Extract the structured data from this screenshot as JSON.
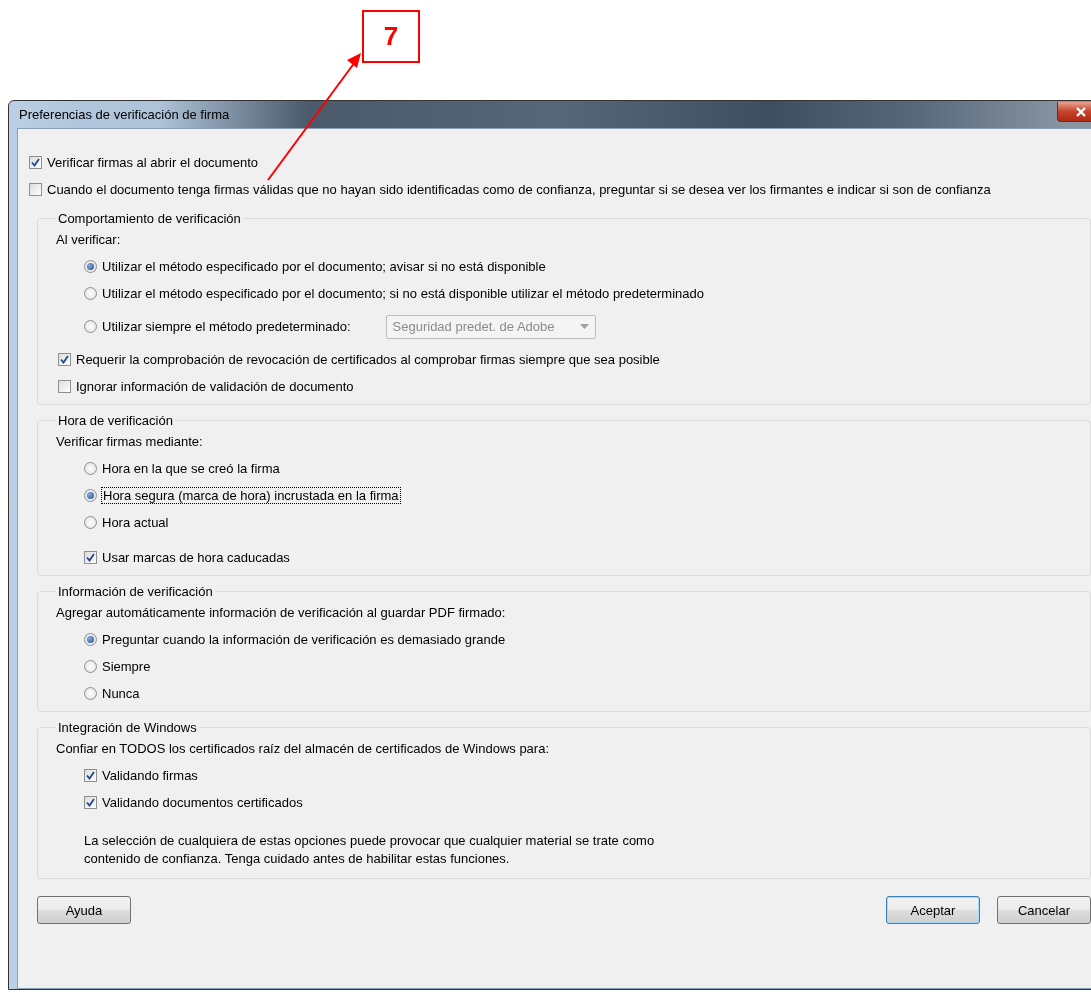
{
  "annotation": {
    "label": "7"
  },
  "window": {
    "title": "Preferencias de verificación de firma"
  },
  "top_options": [
    {
      "label": "Verificar firmas al abrir el documento",
      "checked": true
    },
    {
      "label": "Cuando el documento tenga firmas válidas que no hayan sido identificadas como de confianza, preguntar si se desea ver los firmantes e indicar si son de confianza",
      "checked": false
    }
  ],
  "sections": [
    {
      "title": "Comportamiento de verificación",
      "prompt": "Al verificar:",
      "items": [
        {
          "kind": "radio",
          "label": "Utilizar el método especificado por el documento; avisar si no está disponible",
          "selected": true
        },
        {
          "kind": "radio",
          "label": "Utilizar el método especificado por el documento; si no está disponible utilizar el método predeterminado",
          "selected": false
        },
        {
          "kind": "radio",
          "label": "Utilizar siempre el método predeterminado:",
          "selected": false,
          "dropdown": {
            "value": "Seguridad predet. de Adobe",
            "disabled": true
          }
        },
        {
          "kind": "setting",
          "label": "Requerir la comprobación de revocación de certificados al comprobar firmas siempre que sea posible",
          "checked": true
        },
        {
          "kind": "setting",
          "label": "Ignorar información de validación de documento",
          "checked": false
        }
      ]
    },
    {
      "title": "Hora de verificación",
      "prompt": "Verificar firmas mediante:",
      "items": [
        {
          "kind": "radio",
          "label": "Hora en la que se creó la firma",
          "selected": false
        },
        {
          "kind": "radio",
          "label": "Hora segura (marca de hora) incrustada en la firma",
          "selected": true
        },
        {
          "kind": "radio",
          "label": "Hora actual",
          "selected": false
        },
        {
          "kind": "check",
          "label": "Usar marcas de hora caducadas",
          "checked": true
        }
      ]
    },
    {
      "title": "Información de verificación",
      "prompt": "Agregar automáticamente información de verificación al guardar PDF firmado:",
      "items": [
        {
          "kind": "radio",
          "label": "Preguntar cuando la información de verificación es demasiado grande",
          "selected": true
        },
        {
          "kind": "radio",
          "label": "Siempre",
          "selected": false
        },
        {
          "kind": "radio",
          "label": "Nunca",
          "selected": false
        }
      ]
    },
    {
      "title": "Integración de Windows",
      "prompt": "Confiar en TODOS los certificados raíz del almacén de certificados de Windows para:",
      "items": [
        {
          "kind": "check",
          "label": "Validando firmas",
          "checked": true
        },
        {
          "kind": "check",
          "label": "Validando documentos certificados",
          "checked": true
        }
      ],
      "note": "La selección de cualquiera de estas opciones puede provocar que cualquier material se trate como contenido de confianza. Tenga cuidado antes de habilitar estas funciones."
    }
  ],
  "buttons": {
    "left": [
      "Ayuda"
    ],
    "right": [
      {
        "label": "Aceptar",
        "default": true
      },
      {
        "label": "Cancelar",
        "default": false
      }
    ]
  }
}
